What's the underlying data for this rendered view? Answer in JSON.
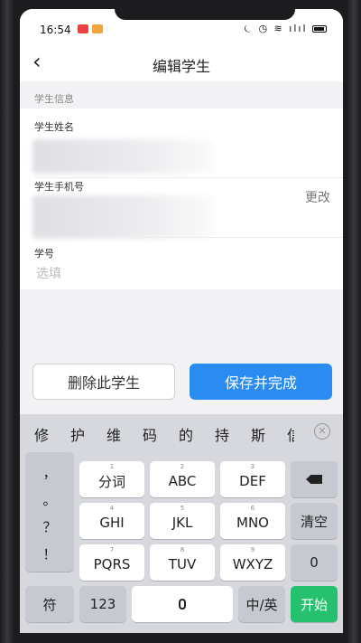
{
  "status": {
    "time": "16:54",
    "right_icons": "⏾ ◷ ≋ ılıl"
  },
  "nav": {
    "back_icon": "chevron-left",
    "title": "编辑学生"
  },
  "section": {
    "header": "学生信息"
  },
  "fields": {
    "name_label": "学生姓名",
    "phone_label": "学生手机号",
    "change_label": "更改",
    "student_no_label": "学号",
    "student_no_placeholder": "选填"
  },
  "buttons": {
    "delete": "删除此学生",
    "save": "保存并完成"
  },
  "keyboard": {
    "candidates": [
      "修",
      "护",
      "维",
      "码",
      "的",
      "持",
      "斯",
      "信"
    ],
    "punctuation": [
      "，",
      "。",
      "？",
      "！"
    ],
    "row1": [
      {
        "num": "1",
        "label": "分词"
      },
      {
        "num": "2",
        "label": "ABC"
      },
      {
        "num": "3",
        "label": "DEF"
      }
    ],
    "row2": [
      {
        "num": "4",
        "label": "GHI"
      },
      {
        "num": "5",
        "label": "JKL"
      },
      {
        "num": "6",
        "label": "MNO"
      }
    ],
    "row3": [
      {
        "num": "7",
        "label": "PQRS"
      },
      {
        "num": "8",
        "label": "TUV"
      },
      {
        "num": "9",
        "label": "WXYZ"
      }
    ],
    "right_keys": [
      "清空",
      "0"
    ],
    "bottom": {
      "symbol": "符",
      "numbers": "123",
      "lang": "中/英",
      "go": "开始"
    },
    "accent": "#25c16f"
  },
  "colors": {
    "primary": "#2a8cf0"
  }
}
